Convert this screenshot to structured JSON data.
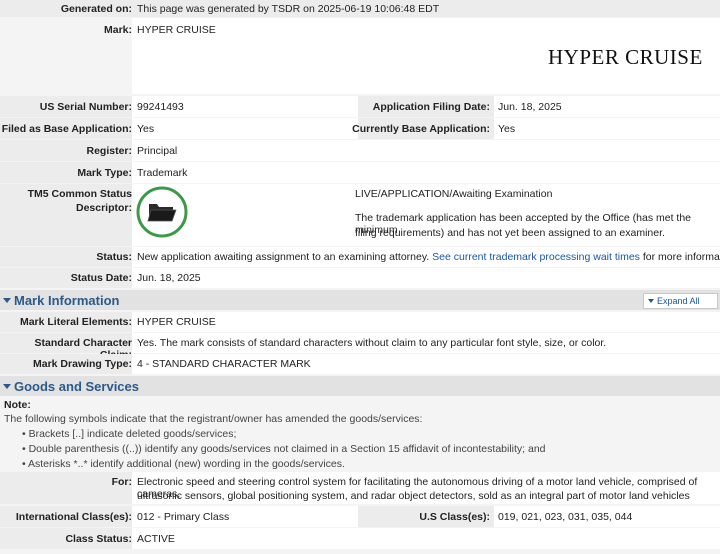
{
  "header": {
    "generated_label": "Generated on:",
    "generated_value": "This page was generated by TSDR on 2025-06-19 10:06:48 EDT"
  },
  "mark": {
    "label": "Mark:",
    "value": "HYPER CRUISE",
    "image_text": "HYPER CRUISE"
  },
  "fields": {
    "serial_label": "US Serial Number:",
    "serial_value": "99241493",
    "filing_date_label": "Application Filing Date:",
    "filing_date_value": "Jun. 18, 2025",
    "filed_base_label": "Filed as Base Application:",
    "filed_base_value": "Yes",
    "current_base_label": "Currently Base Application:",
    "current_base_value": "Yes",
    "register_label": "Register:",
    "register_value": "Principal",
    "mark_type_label": "Mark Type:",
    "mark_type_value": "Trademark",
    "tm5_label_1": "TM5 Common Status",
    "tm5_label_2": "Descriptor:",
    "tm5_status": "LIVE/APPLICATION/Awaiting Examination",
    "tm5_desc_1": "The trademark application has been accepted by the Office (has met the minimum",
    "tm5_desc_2": "filing requirements) and has not yet been assigned to an examiner.",
    "status_label": "Status:",
    "status_text": "New application awaiting assignment to an examining attorney.",
    "status_link": "See current trademark processing wait times",
    "status_suffix": "for more information.",
    "status_date_label": "Status Date:",
    "status_date_value": "Jun. 18, 2025"
  },
  "mark_information": {
    "title": "Mark Information",
    "expand_all": "Expand All",
    "literal_label": "Mark Literal Elements:",
    "literal_value": "HYPER CRUISE",
    "claim_label": "Standard Character Claim:",
    "claim_value": "Yes. The mark consists of standard characters without claim to any particular font style, size, or color.",
    "drawing_label": "Mark Drawing Type:",
    "drawing_value": "4 - STANDARD CHARACTER MARK"
  },
  "goods_services": {
    "title": "Goods and Services",
    "note_label": "Note:",
    "note_text": "The following symbols indicate that the registrant/owner has amended the goods/services:",
    "bullets": [
      "Brackets [..] indicate deleted goods/services;",
      "Double parenthesis ((..)) identify any goods/services not claimed in a Section 15 affidavit of incontestability; and",
      "Asterisks *..* identify additional (new) wording in the goods/services."
    ],
    "for_label": "For:",
    "for_value_1": "Electronic speed and steering control system for facilitating the autonomous driving of a motor land vehicle, comprised of cameras,",
    "for_value_2": "ultrasonic sensors, global positioning system, and radar object detectors, sold as an integral part of motor land vehicles",
    "intl_class_label": "International Class(es):",
    "intl_class_value": "012 - Primary Class",
    "us_class_label": "U.S Class(es):",
    "us_class_value": "019, 021, 023, 031, 035, 044",
    "class_status_label": "Class Status:",
    "class_status_value": "ACTIVE"
  },
  "colors": {
    "section_title": "#2b5a8a",
    "link": "#1a56a8",
    "status_icon_ring": "#3a9a4a"
  }
}
